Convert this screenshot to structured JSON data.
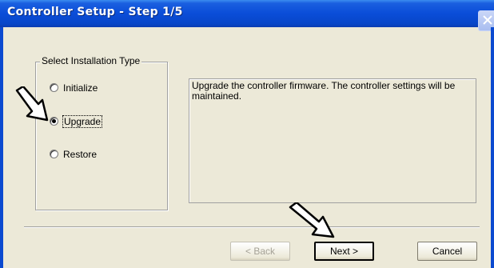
{
  "window": {
    "title": "Controller Setup - Step 1/5"
  },
  "install_type": {
    "group_label": "Select Installation Type",
    "options": [
      {
        "label": "Initialize",
        "selected": false
      },
      {
        "label": "Upgrade",
        "selected": true
      },
      {
        "label": "Restore",
        "selected": false
      }
    ]
  },
  "description": {
    "text": "Upgrade the controller firmware. The controller settings will be maintained."
  },
  "buttons": {
    "back": "< Back",
    "next": "Next >",
    "cancel": "Cancel"
  },
  "icons": {
    "close": "close-icon",
    "pointer": "hollow-arrow-icon"
  }
}
